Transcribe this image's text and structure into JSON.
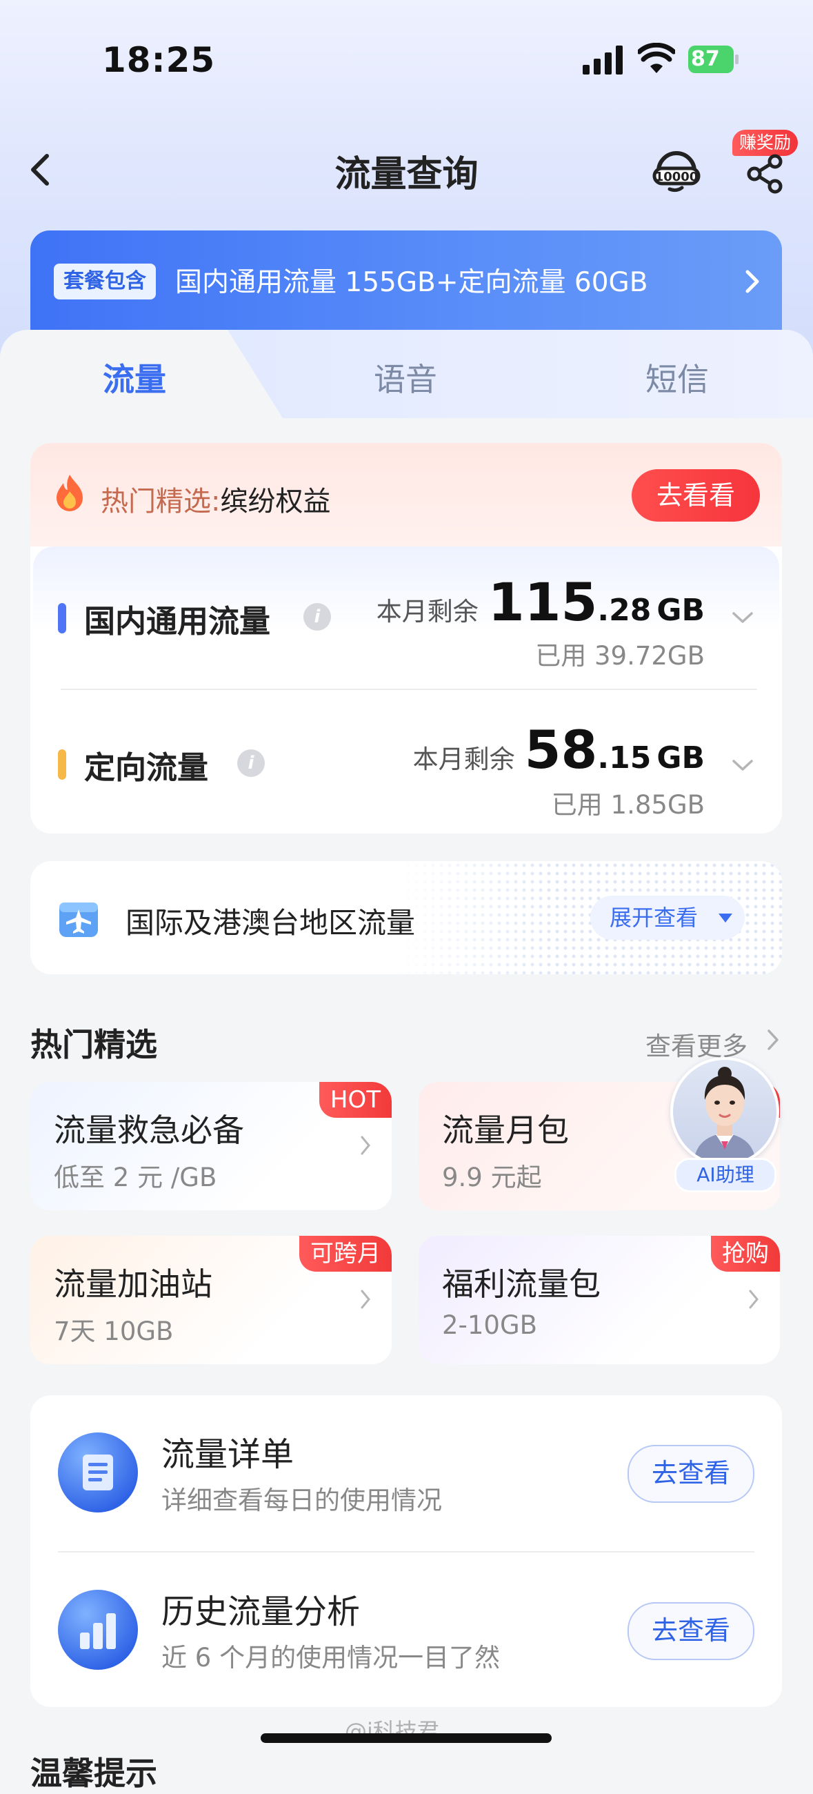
{
  "status_bar": {
    "time": "18:25",
    "battery": "87"
  },
  "nav": {
    "title": "流量查询",
    "reward_badge": "赚奖励"
  },
  "package_banner": {
    "tag": "套餐包含",
    "text": "国内通用流量 155GB+定向流量 60GB"
  },
  "tabs": [
    {
      "label": "流量",
      "active": true
    },
    {
      "label": "语音",
      "active": false
    },
    {
      "label": "短信",
      "active": false
    }
  ],
  "hot_pick": {
    "label": "热门精选:",
    "label_strong": "缤纷权益",
    "button": "去看看"
  },
  "usage": [
    {
      "name": "国内通用流量",
      "remain_label": "本月剩余",
      "remain_int": "115",
      "remain_dec": ".28",
      "unit": "GB",
      "used": "已用 39.72GB",
      "marker_color": "#4f74f6"
    },
    {
      "name": "定向流量",
      "remain_label": "本月剩余",
      "remain_int": "58",
      "remain_dec": ".15",
      "unit": "GB",
      "used": "已用 1.85GB",
      "marker_color": "#f7b84a"
    }
  ],
  "international": {
    "text": "国际及港澳台地区流量",
    "button": "展开查看"
  },
  "hot_section": {
    "title": "热门精选",
    "see_more": "查看更多"
  },
  "promos": [
    {
      "title": "流量救急必备",
      "sub": "低至 2 元 /GB",
      "badge": "HOT"
    },
    {
      "title": "流量月包",
      "sub": "9.9 元起",
      "badge": ""
    },
    {
      "title": "流量加油站",
      "sub": "7天 10GB",
      "badge": "可跨月"
    },
    {
      "title": "福利流量包",
      "sub": "2-10GB",
      "badge": "抢购"
    }
  ],
  "ai_assistant": {
    "label": "AI助理"
  },
  "details": [
    {
      "title": "流量详单",
      "desc": "详细查看每日的使用情况",
      "button": "去查看"
    },
    {
      "title": "历史流量分析",
      "desc": "近 6 个月的使用情况一目了然",
      "button": "去查看"
    }
  ],
  "tip_title": "温馨提示",
  "watermark": "@i科技君",
  "colors": {
    "accent": "#3a6df0",
    "hot_red": "#f6353c",
    "banner_blue": "#3f73f6"
  }
}
